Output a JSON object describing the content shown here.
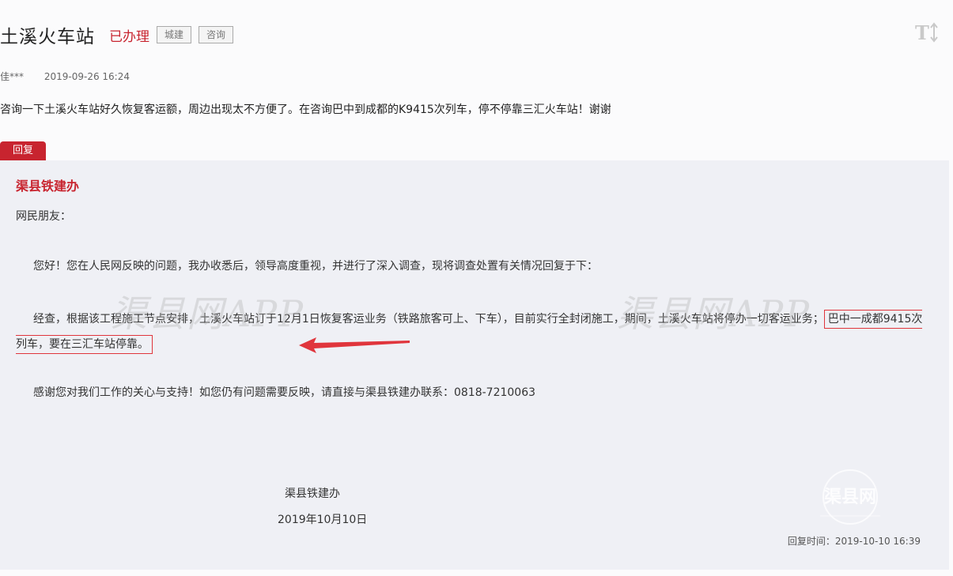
{
  "header": {
    "title": "土溪火车站",
    "status": "已办理",
    "tags": [
      "城建",
      "咨询"
    ],
    "font_toggle_icon": "text-size-icon"
  },
  "meta": {
    "author": "佳***",
    "date": "2019-09-26 16:24"
  },
  "question": "咨询一下土溪火车站好久恢复客运额，周边出现太不方便了。在咨询巴中到成都的K9415次列车，停不停靠三汇火车站！谢谢",
  "reply": {
    "badge": "回复",
    "org": "渠县铁建办",
    "greeting": "网民朋友：",
    "p1": "您好！您在人民网反映的问题，我办收悉后，领导高度重视，并进行了深入调查，现将调查处置有关情况回复于下：",
    "p2_start": "经查，根据该工程施工节点安排，土溪火车站订于12月1日恢复客运业务（铁路旅客可上、下车），目前实行全封闭施工，期间，土溪火车站将停办一切客运业务；",
    "p2_highlight": "巴中一成都9415次列车，要在三汇车站停靠。",
    "p3": "感谢您对我们工作的关心与支持！如您仍有问题需要反映，请直接与渠县铁建办联系：0818-7210063",
    "signature": "渠县铁建办",
    "sign_date": "2019年10月10日",
    "reply_time": "回复时间：2019-10-10 16:39"
  },
  "watermarks": [
    "渠县网APP",
    "渠县网APP"
  ],
  "logo_watermark": "渠县网",
  "colors": {
    "accent": "#c8242f",
    "reply_bg": "#eff0f5",
    "annotation": "#e0353c"
  }
}
